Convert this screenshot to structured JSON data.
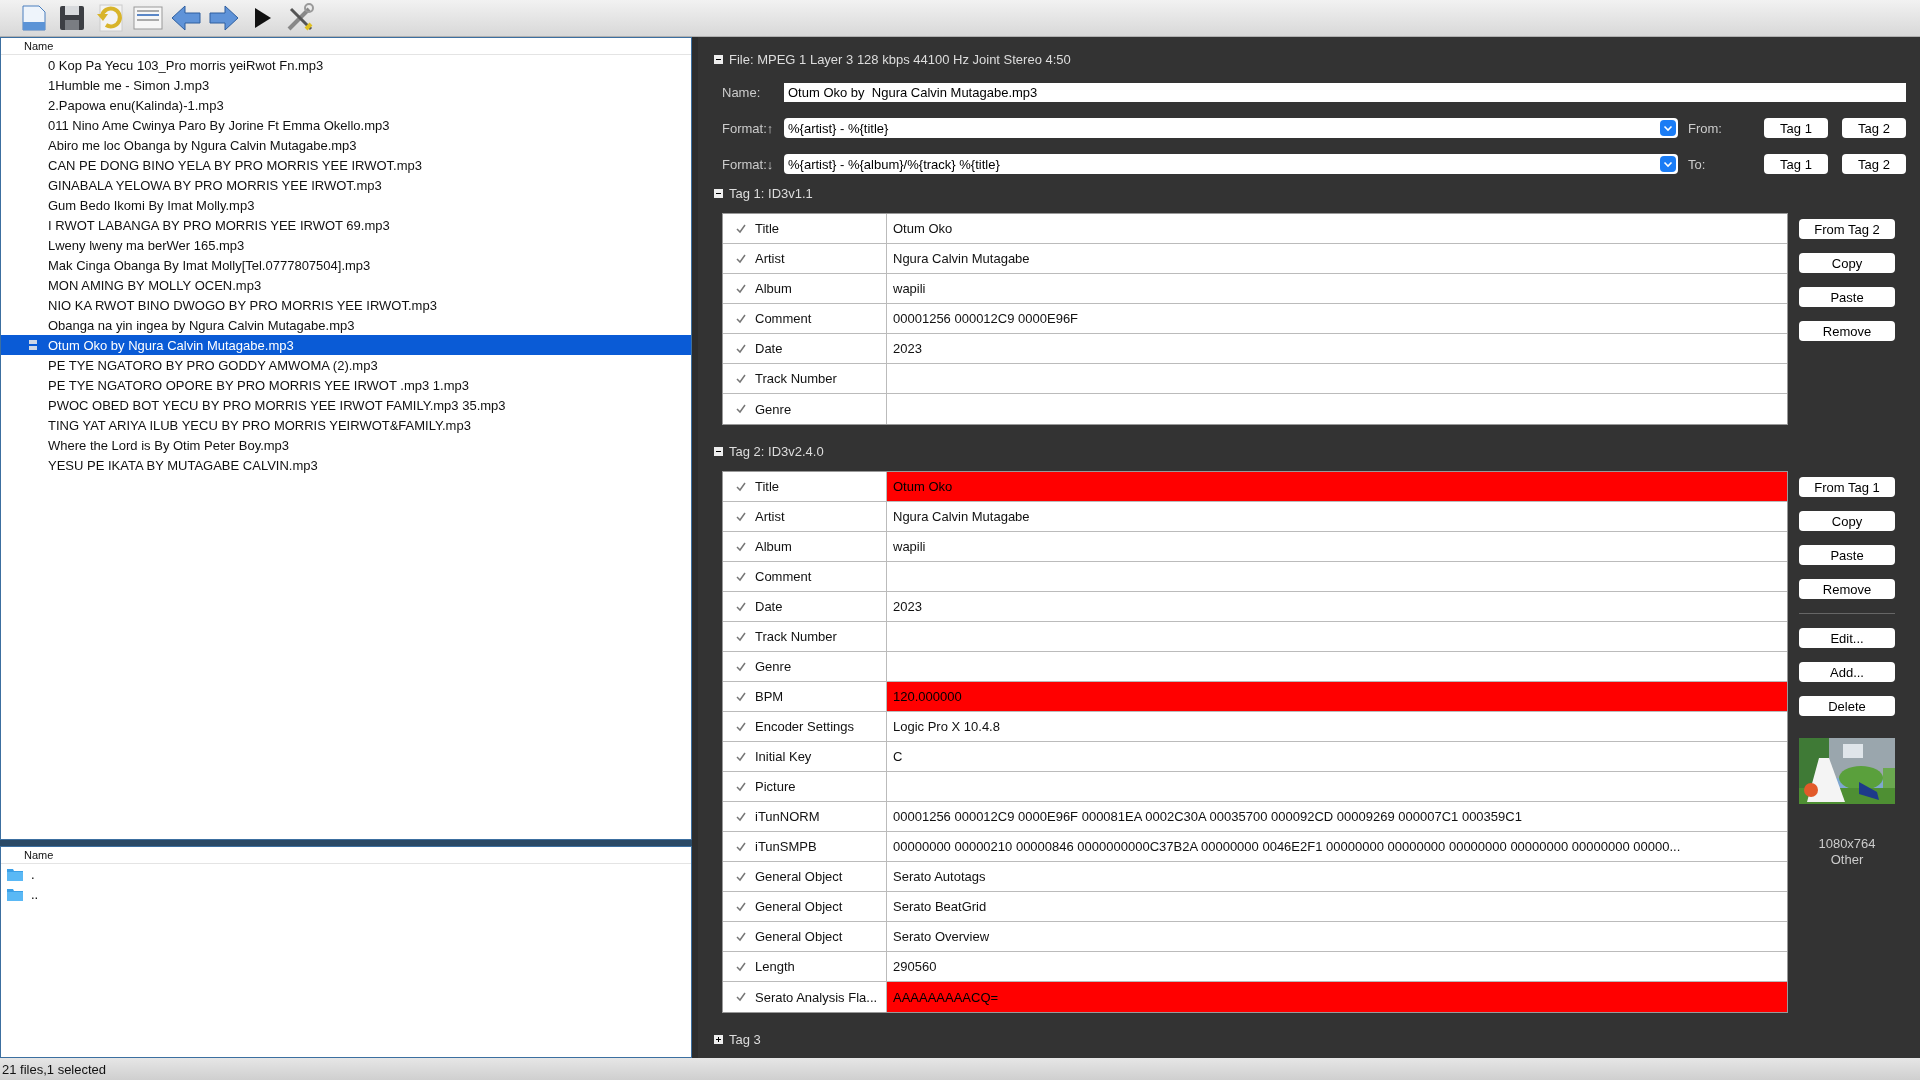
{
  "toolbar": [
    {
      "kind": "new"
    },
    {
      "kind": "save"
    },
    {
      "kind": "undo"
    },
    {
      "kind": "form"
    },
    {
      "kind": "back"
    },
    {
      "kind": "forward"
    },
    {
      "kind": "play"
    },
    {
      "kind": "tools"
    }
  ],
  "file_list": {
    "header": "Name",
    "rows": [
      {
        "name": "0 Kop Pa Yecu 103_Pro morris yeiRwot Fn.mp3",
        "selected": false
      },
      {
        "name": "1Humble me - Simon J.mp3",
        "selected": false
      },
      {
        "name": "2.Papowa enu(Kalinda)-1.mp3",
        "selected": false
      },
      {
        "name": "011 Nino Ame Cwinya Paro By Jorine Ft Emma Okello.mp3",
        "selected": false
      },
      {
        "name": "Abiro me loc Obanga by Ngura Calvin Mutagabe.mp3",
        "selected": false
      },
      {
        "name": "CAN PE DONG BINO YELA BY PRO MORRIS YEE IRWOT.mp3",
        "selected": false
      },
      {
        "name": "GINABALA YELOWA BY PRO MORRIS YEE IRWOT.mp3",
        "selected": false
      },
      {
        "name": "Gum Bedo Ikomi By Imat Molly.mp3",
        "selected": false
      },
      {
        "name": "I RWOT LABANGA  BY PRO MORRIS YEE IRWOT 69.mp3",
        "selected": false
      },
      {
        "name": "Lweny lweny ma berWer 165.mp3",
        "selected": false
      },
      {
        "name": "Mak Cinga Obanga By Imat Molly[Tel.0777807504].mp3",
        "selected": false
      },
      {
        "name": "MON AMING BY MOLLY OCEN.mp3",
        "selected": false
      },
      {
        "name": "NIO KA RWOT BINO DWOGO BY PRO MORRIS YEE IRWOT.mp3",
        "selected": false
      },
      {
        "name": "Obanga na yin ingea by Ngura Calvin Mutagabe.mp3",
        "selected": false
      },
      {
        "name": "Otum Oko by  Ngura Calvin Mutagabe.mp3",
        "selected": true
      },
      {
        "name": "PE TYE NGATORO BY PRO GODDY AMWOMA (2).mp3",
        "selected": false
      },
      {
        "name": "PE TYE NGATORO OPORE BY PRO MORRIS YEE IRWOT .mp3 1.mp3",
        "selected": false
      },
      {
        "name": "PWOC OBED BOT YECU BY PRO MORRIS YEE IRWOT FAMILY.mp3 35.mp3",
        "selected": false
      },
      {
        "name": "TING YAT ARIYA ILUB YECU BY PRO MORRIS YEIRWOT&FAMILY.mp3",
        "selected": false
      },
      {
        "name": "Where the Lord is By Otim Peter Boy.mp3",
        "selected": false
      },
      {
        "name": "YESU  PE  IKATA  BY  MUTAGABE  CALVIN.mp3",
        "selected": false
      }
    ]
  },
  "dir_list": {
    "header": "Name",
    "rows": [
      {
        "name": "."
      },
      {
        "name": ".."
      }
    ]
  },
  "status_bar": "21 files,1 selected",
  "file_info": {
    "label": "File: MPEG 1 Layer 3 128 kbps 44100 Hz Joint Stereo 4:50",
    "expanded": true
  },
  "name_field": {
    "label": "Name:",
    "value": "Otum Oko by  Ngura Calvin Mutagabe.mp3"
  },
  "format_rows": [
    {
      "label": "Format:↑",
      "value": "%{artist} - %{title}",
      "direction_label": "From:",
      "buttons": [
        "Tag 1",
        "Tag 2"
      ]
    },
    {
      "label": "Format:↓",
      "value": "%{artist} - %{album}/%{track} %{title}",
      "direction_label": "To:",
      "buttons": [
        "Tag 1",
        "Tag 2"
      ]
    }
  ],
  "tags": [
    {
      "title": "Tag 1: ID3v1.1",
      "expanded": true,
      "frames": [
        {
          "field": "Title",
          "value": "Otum Oko",
          "checked": true,
          "highlighted": false
        },
        {
          "field": "Artist",
          "value": "Ngura Calvin Mutagabe",
          "checked": true,
          "highlighted": false
        },
        {
          "field": "Album",
          "value": "wapili",
          "checked": true,
          "highlighted": false
        },
        {
          "field": "Comment",
          "value": "00001256 000012C9 0000E96F",
          "checked": true,
          "highlighted": false
        },
        {
          "field": "Date",
          "value": "2023",
          "checked": true,
          "highlighted": false
        },
        {
          "field": "Track Number",
          "checked": true,
          "highlighted": false
        },
        {
          "field": "Genre",
          "checked": true,
          "highlighted": false
        }
      ],
      "buttons": [
        "From Tag 2",
        "Copy",
        "Paste",
        "Remove"
      ]
    },
    {
      "title": "Tag 2: ID3v2.4.0",
      "expanded": true,
      "frames": [
        {
          "field": "Title",
          "value": "Otum Oko",
          "checked": true,
          "highlighted": true
        },
        {
          "field": "Artist",
          "value": "Ngura Calvin Mutagabe",
          "checked": true,
          "highlighted": false
        },
        {
          "field": "Album",
          "value": "wapili",
          "checked": true,
          "highlighted": false
        },
        {
          "field": "Comment",
          "checked": true,
          "highlighted": false
        },
        {
          "field": "Date",
          "value": "2023",
          "checked": true,
          "highlighted": false
        },
        {
          "field": "Track Number",
          "checked": true,
          "highlighted": false
        },
        {
          "field": "Genre",
          "checked": true,
          "highlighted": false
        },
        {
          "field": "BPM",
          "value": "120.000000",
          "checked": true,
          "highlighted": true
        },
        {
          "field": "Encoder Settings",
          "value": "Logic Pro X 10.4.8",
          "checked": true,
          "highlighted": false
        },
        {
          "field": "Initial Key",
          "value": "C",
          "checked": true,
          "highlighted": false
        },
        {
          "field": "Picture",
          "checked": true,
          "highlighted": false
        },
        {
          "field": "iTunNORM",
          "value": "00001256 000012C9 0000E96F 000081EA 0002C30A 00035700 000092CD 00009269 000007C1 000359C1",
          "checked": true,
          "highlighted": false
        },
        {
          "field": "iTunSMPB",
          "value": "00000000 00000210 00000846 0000000000C37B2A 00000000 0046E2F1 00000000 00000000 00000000 00000000 00000000 00000...",
          "checked": true,
          "highlighted": false
        },
        {
          "field": "General Object",
          "value": "Serato Autotags",
          "checked": true,
          "highlighted": false
        },
        {
          "field": "General Object",
          "value": "Serato BeatGrid",
          "checked": true,
          "highlighted": false
        },
        {
          "field": "General Object",
          "value": "Serato Overview",
          "checked": true,
          "highlighted": false
        },
        {
          "field": "Length",
          "value": "290560",
          "checked": true,
          "highlighted": false
        },
        {
          "field": "Serato Analysis Fla...",
          "value": "AAAAAAAAACQ=",
          "checked": true,
          "highlighted": true
        }
      ],
      "buttons": [
        "From Tag 1",
        "Copy",
        "Paste",
        "Remove"
      ],
      "frame_buttons": [
        "Edit...",
        "Add...",
        "Delete"
      ],
      "picture": {
        "kind": "picture",
        "size": "1080x764",
        "type": "Other"
      }
    },
    {
      "title": "Tag 3",
      "expanded": false
    }
  ]
}
